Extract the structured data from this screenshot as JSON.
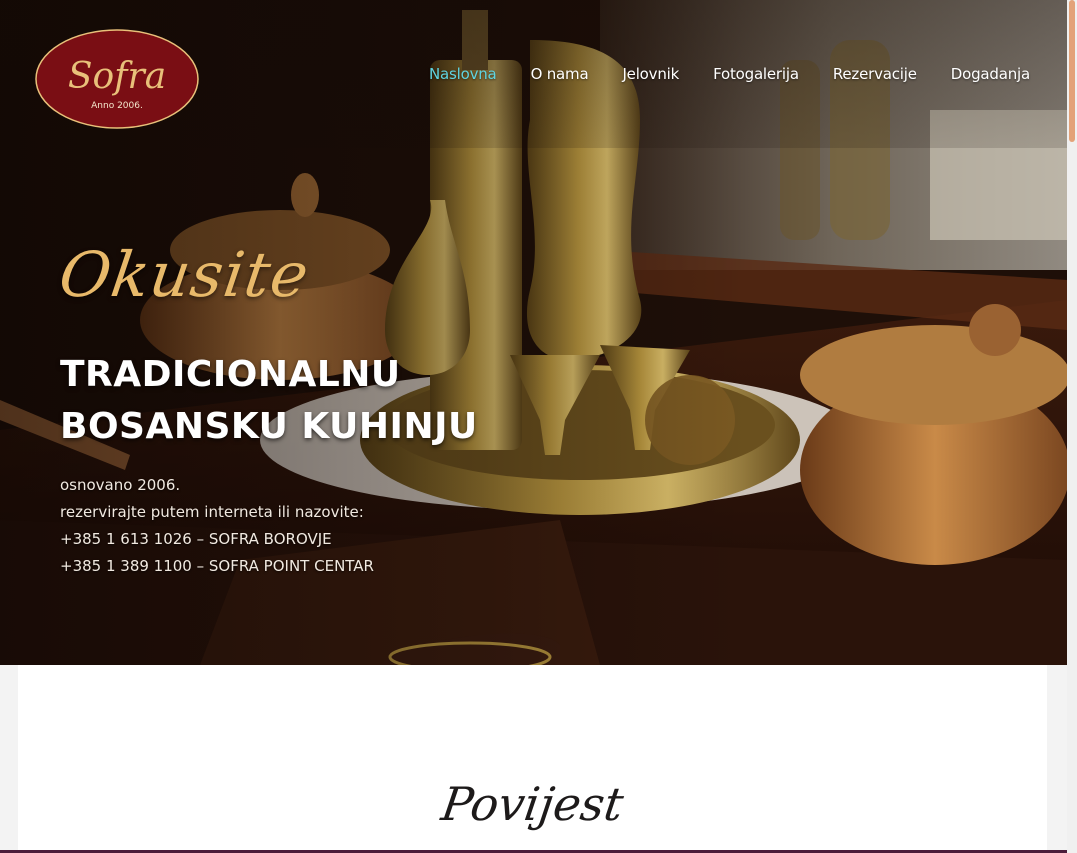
{
  "brand": {
    "logo_text": "Sofra",
    "logo_tagline": "Anno 2006.",
    "logo_color": "#7a0e14",
    "logo_text_color": "#e8c07a"
  },
  "nav": {
    "items": [
      {
        "label": "Naslovna",
        "active": true
      },
      {
        "label": "O nama",
        "active": false
      },
      {
        "label": "Jelovnik",
        "active": false
      },
      {
        "label": "Fotogalerija",
        "active": false
      },
      {
        "label": "Rezervacije",
        "active": false
      },
      {
        "label": "Dogadanja",
        "active": false
      }
    ],
    "active_color": "#5fd3e0"
  },
  "hero": {
    "script_title": "Okusite",
    "headline_line1": "TRADICIONALNU",
    "headline_line2": "BOSANSKU KUHINJU",
    "info_lines": [
      "osnovano 2006.",
      "rezervirajte putem interneta ili nazovite:",
      "+385 1 613 1026 – SOFRA BOROVJE",
      "+385 1 389 1100 – SOFRA POINT CENTAR"
    ],
    "accent_color": "#e8b96a"
  },
  "section": {
    "title": "Povijest"
  }
}
